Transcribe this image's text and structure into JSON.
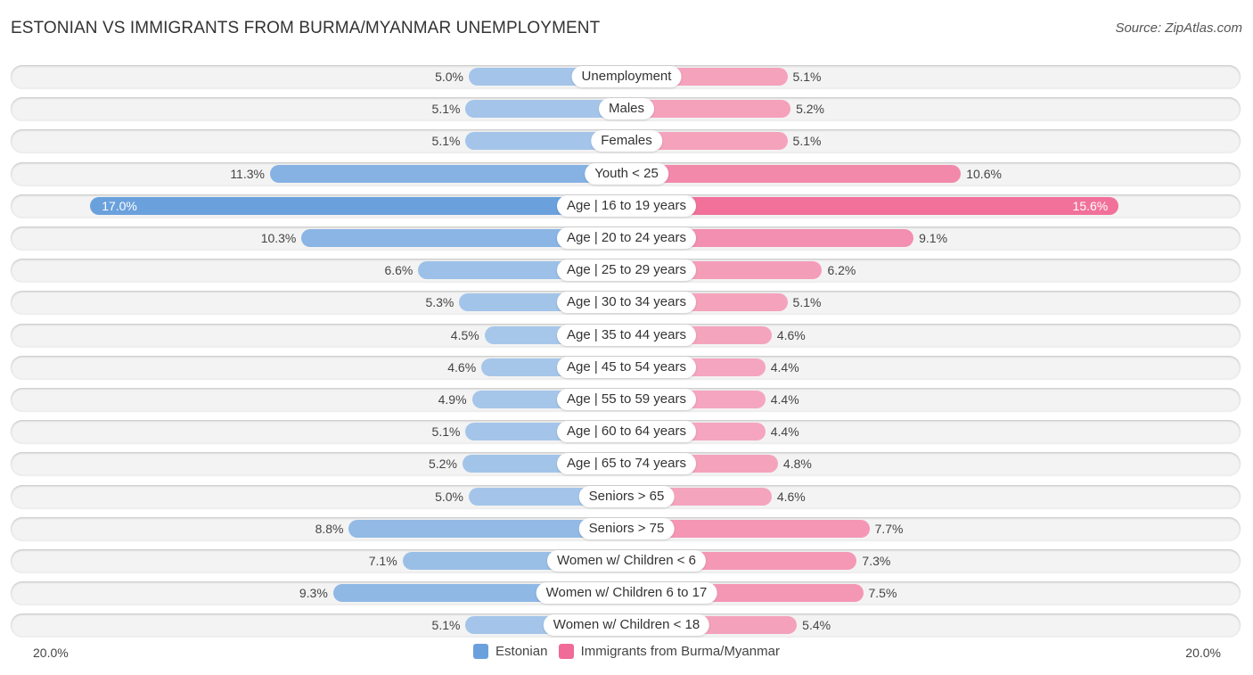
{
  "header": {
    "title": "ESTONIAN VS IMMIGRANTS FROM BURMA/MYANMAR UNEMPLOYMENT",
    "source": "Source: ZipAtlas.com"
  },
  "colors": {
    "estonian": "#6aa1dd",
    "estonian_light": "#a9c8ea",
    "immigrants": "#f06b97",
    "immigrants_light": "#f5a7c0"
  },
  "chart_data": {
    "type": "bar",
    "orientation": "horizontal-diverging",
    "title": "ESTONIAN VS IMMIGRANTS FROM BURMA/MYANMAR UNEMPLOYMENT",
    "xlabel": "",
    "ylabel": "",
    "xlim": [
      -20,
      20
    ],
    "axis_min_label": "20.0%",
    "axis_max_label": "20.0%",
    "legend_position": "bottom-center",
    "categories": [
      "Unemployment",
      "Males",
      "Females",
      "Youth < 25",
      "Age | 16 to 19 years",
      "Age | 20 to 24 years",
      "Age | 25 to 29 years",
      "Age | 30 to 34 years",
      "Age | 35 to 44 years",
      "Age | 45 to 54 years",
      "Age | 55 to 59 years",
      "Age | 60 to 64 years",
      "Age | 65 to 74 years",
      "Seniors > 65",
      "Seniors > 75",
      "Women w/ Children < 6",
      "Women w/ Children 6 to 17",
      "Women w/ Children < 18"
    ],
    "series": [
      {
        "name": "Estonian",
        "side": "left",
        "values": [
          5.0,
          5.1,
          5.1,
          11.3,
          17.0,
          10.3,
          6.6,
          5.3,
          4.5,
          4.6,
          4.9,
          5.1,
          5.2,
          5.0,
          8.8,
          7.1,
          9.3,
          5.1
        ],
        "labels": [
          "5.0%",
          "5.1%",
          "5.1%",
          "11.3%",
          "17.0%",
          "10.3%",
          "6.6%",
          "5.3%",
          "4.5%",
          "4.6%",
          "4.9%",
          "5.1%",
          "5.2%",
          "5.0%",
          "8.8%",
          "7.1%",
          "9.3%",
          "5.1%"
        ]
      },
      {
        "name": "Immigrants from Burma/Myanmar",
        "side": "right",
        "values": [
          5.1,
          5.2,
          5.1,
          10.6,
          15.6,
          9.1,
          6.2,
          5.1,
          4.6,
          4.4,
          4.4,
          4.4,
          4.8,
          4.6,
          7.7,
          7.3,
          7.5,
          5.4
        ],
        "labels": [
          "5.1%",
          "5.2%",
          "5.1%",
          "10.6%",
          "15.6%",
          "9.1%",
          "6.2%",
          "5.1%",
          "4.6%",
          "4.4%",
          "4.4%",
          "4.4%",
          "4.8%",
          "4.6%",
          "7.7%",
          "7.3%",
          "7.5%",
          "5.4%"
        ]
      }
    ]
  },
  "legend": {
    "items": [
      {
        "label": "Estonian"
      },
      {
        "label": "Immigrants from Burma/Myanmar"
      }
    ]
  }
}
